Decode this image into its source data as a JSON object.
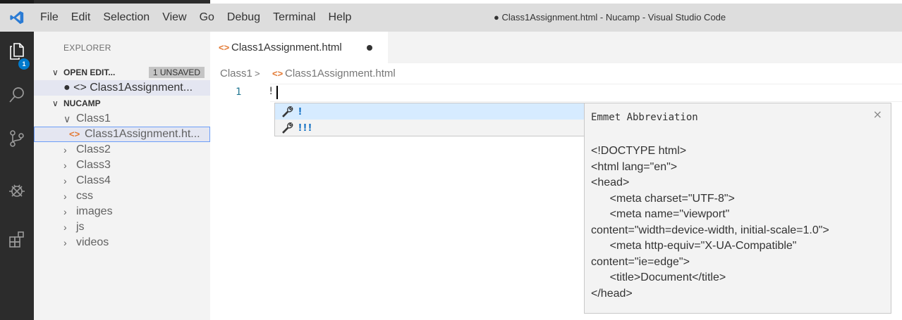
{
  "menu": [
    "File",
    "Edit",
    "Selection",
    "View",
    "Go",
    "Debug",
    "Terminal",
    "Help"
  ],
  "window_title": "● Class1Assignment.html - Nucamp - Visual Studio Code",
  "activity": {
    "explorer_badge": "1"
  },
  "sidebar": {
    "title": "EXPLORER",
    "open_editors": {
      "label": "OPEN EDIT...",
      "badge": "1 UNSAVED",
      "file": "● <> Class1Assignment..."
    },
    "project": "NUCAMP",
    "tree": [
      {
        "label": "Class1",
        "chev": "∨"
      },
      {
        "label": "Class1Assignment.ht..."
      },
      {
        "label": "Class2",
        "chev": "›"
      },
      {
        "label": "Class3",
        "chev": "›"
      },
      {
        "label": "Class4",
        "chev": "›"
      },
      {
        "label": "css",
        "chev": "›"
      },
      {
        "label": "images",
        "chev": "›"
      },
      {
        "label": "js",
        "chev": "›"
      },
      {
        "label": "videos",
        "chev": "›"
      }
    ]
  },
  "tab": {
    "label": "Class1Assignment.html"
  },
  "breadcrumb": {
    "folder": "Class1",
    "separator": ">",
    "file": "Class1Assignment.html"
  },
  "editor": {
    "line_number": "1",
    "code": "!"
  },
  "suggest": {
    "items": [
      {
        "label": "!"
      },
      {
        "label": "!!!"
      }
    ]
  },
  "details": {
    "title": "Emmet Abbreviation",
    "close": "×",
    "body": "<!DOCTYPE html>\n<html lang=\"en\">\n<head>\n      <meta charset=\"UTF-8\">\n      <meta name=\"viewport\"\ncontent=\"width=device-width, initial-scale=1.0\">\n      <meta http-equiv=\"X-UA-Compatible\"\ncontent=\"ie=edge\">\n      <title>Document</title>\n</head>"
  },
  "colors": {
    "accent": "#007acc",
    "html_icon": "#e37933",
    "suggest_text": "#0066bf"
  }
}
